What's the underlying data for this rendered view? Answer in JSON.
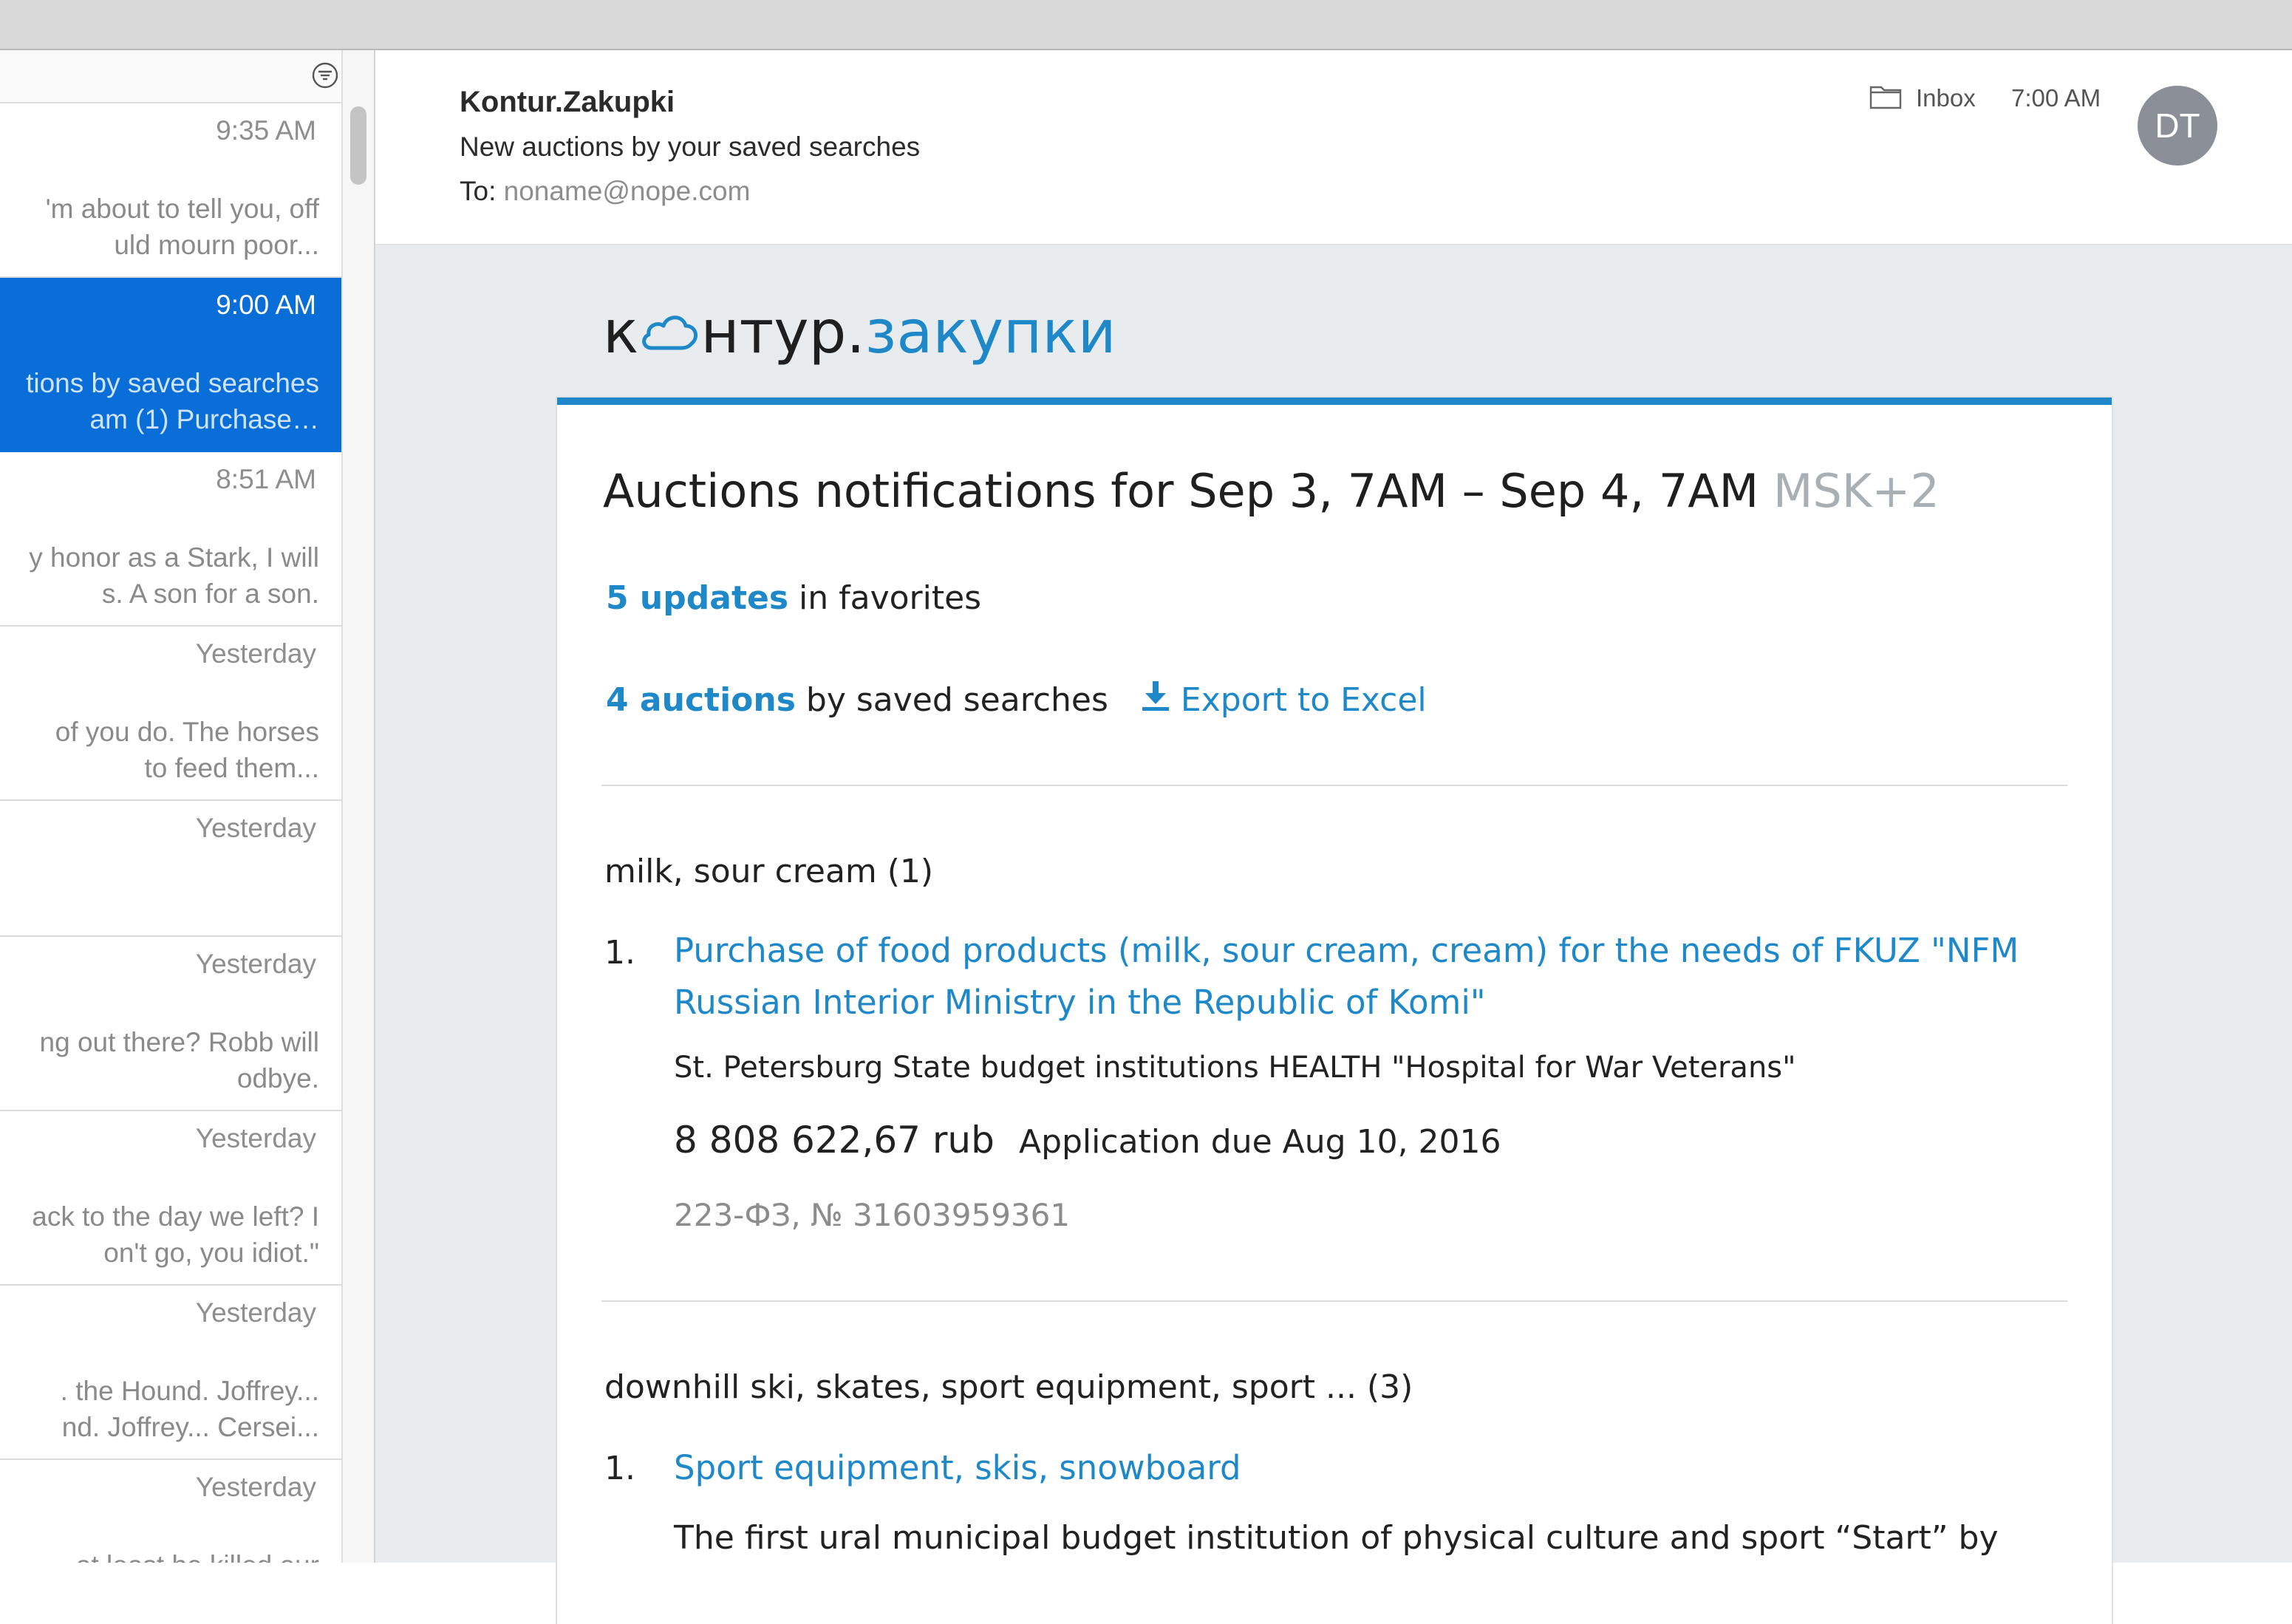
{
  "message_list": {
    "items": [
      {
        "time": "9:35 AM",
        "preview": "'m about to tell you, off\nuld mourn poor..."
      },
      {
        "time": "9:00 AM",
        "preview": "tions by saved searches\nam (1) Purchase…",
        "selected": true
      },
      {
        "time": "8:51 AM",
        "preview": "y honor as a Stark, I will\ns. A son for a son."
      },
      {
        "time": "Yesterday",
        "preview": "of you do. The horses\n to feed them..."
      },
      {
        "time": "Yesterday",
        "preview": ""
      },
      {
        "time": "Yesterday",
        "preview": "ng out there? Robb will\nodbye."
      },
      {
        "time": "Yesterday",
        "preview": "ack to the day we left? I\non't go, you idiot.\""
      },
      {
        "time": "Yesterday",
        "preview": ". the Hound. Joffrey...\nnd. Joffrey... Cersei..."
      },
      {
        "time": "Yesterday",
        "preview": "at least he killed our"
      }
    ]
  },
  "email": {
    "sender": "Kontur.Zakupki",
    "subject": "New auctions by your saved searches",
    "to_label": "To:",
    "to_address": "noname@nope.com",
    "folder": "Inbox",
    "time": "7:00 AM",
    "avatar_initials": "DT"
  },
  "logo": {
    "part_k": "к",
    "part_ntur": "нтур",
    "dot": ".",
    "part_blue": "закупки"
  },
  "card": {
    "title": "Auctions notifications for Sep 3, 7AM – Sep 4, 7AM",
    "timezone": "MSK+2",
    "favorites_count": "5 updates",
    "favorites_text": "in favorites",
    "auctions_count": "4 auctions",
    "auctions_text": "by saved searches",
    "export_label": "Export to Excel",
    "groups": [
      {
        "title": "milk, sour cream (1)",
        "items": [
          {
            "number": "1.",
            "link": "Purchase of food products (milk, sour cream, cream) for the needs of FKUZ \"NFM Russian Interior Ministry in the Republic of Komi\"",
            "organization": "St. Petersburg State budget institutions HEALTH \"Hospital for War Veterans\"",
            "price": "8 808 622,67 rub",
            "due": "Application due Aug 10, 2016",
            "law": "223-ФЗ, № 31603959361"
          }
        ]
      },
      {
        "title": "downhill ski, skates, sport equipment, sport ... (3)",
        "items": [
          {
            "number": "1.",
            "link": "Sport equipment, skis, snowboard",
            "organization": "The first ural municipal budget institution of physical culture and sport “Start” by"
          }
        ]
      }
    ]
  },
  "colors": {
    "accent": "#1e88c9",
    "selection": "#0a6ed8",
    "body_bg": "#e9ecee"
  }
}
